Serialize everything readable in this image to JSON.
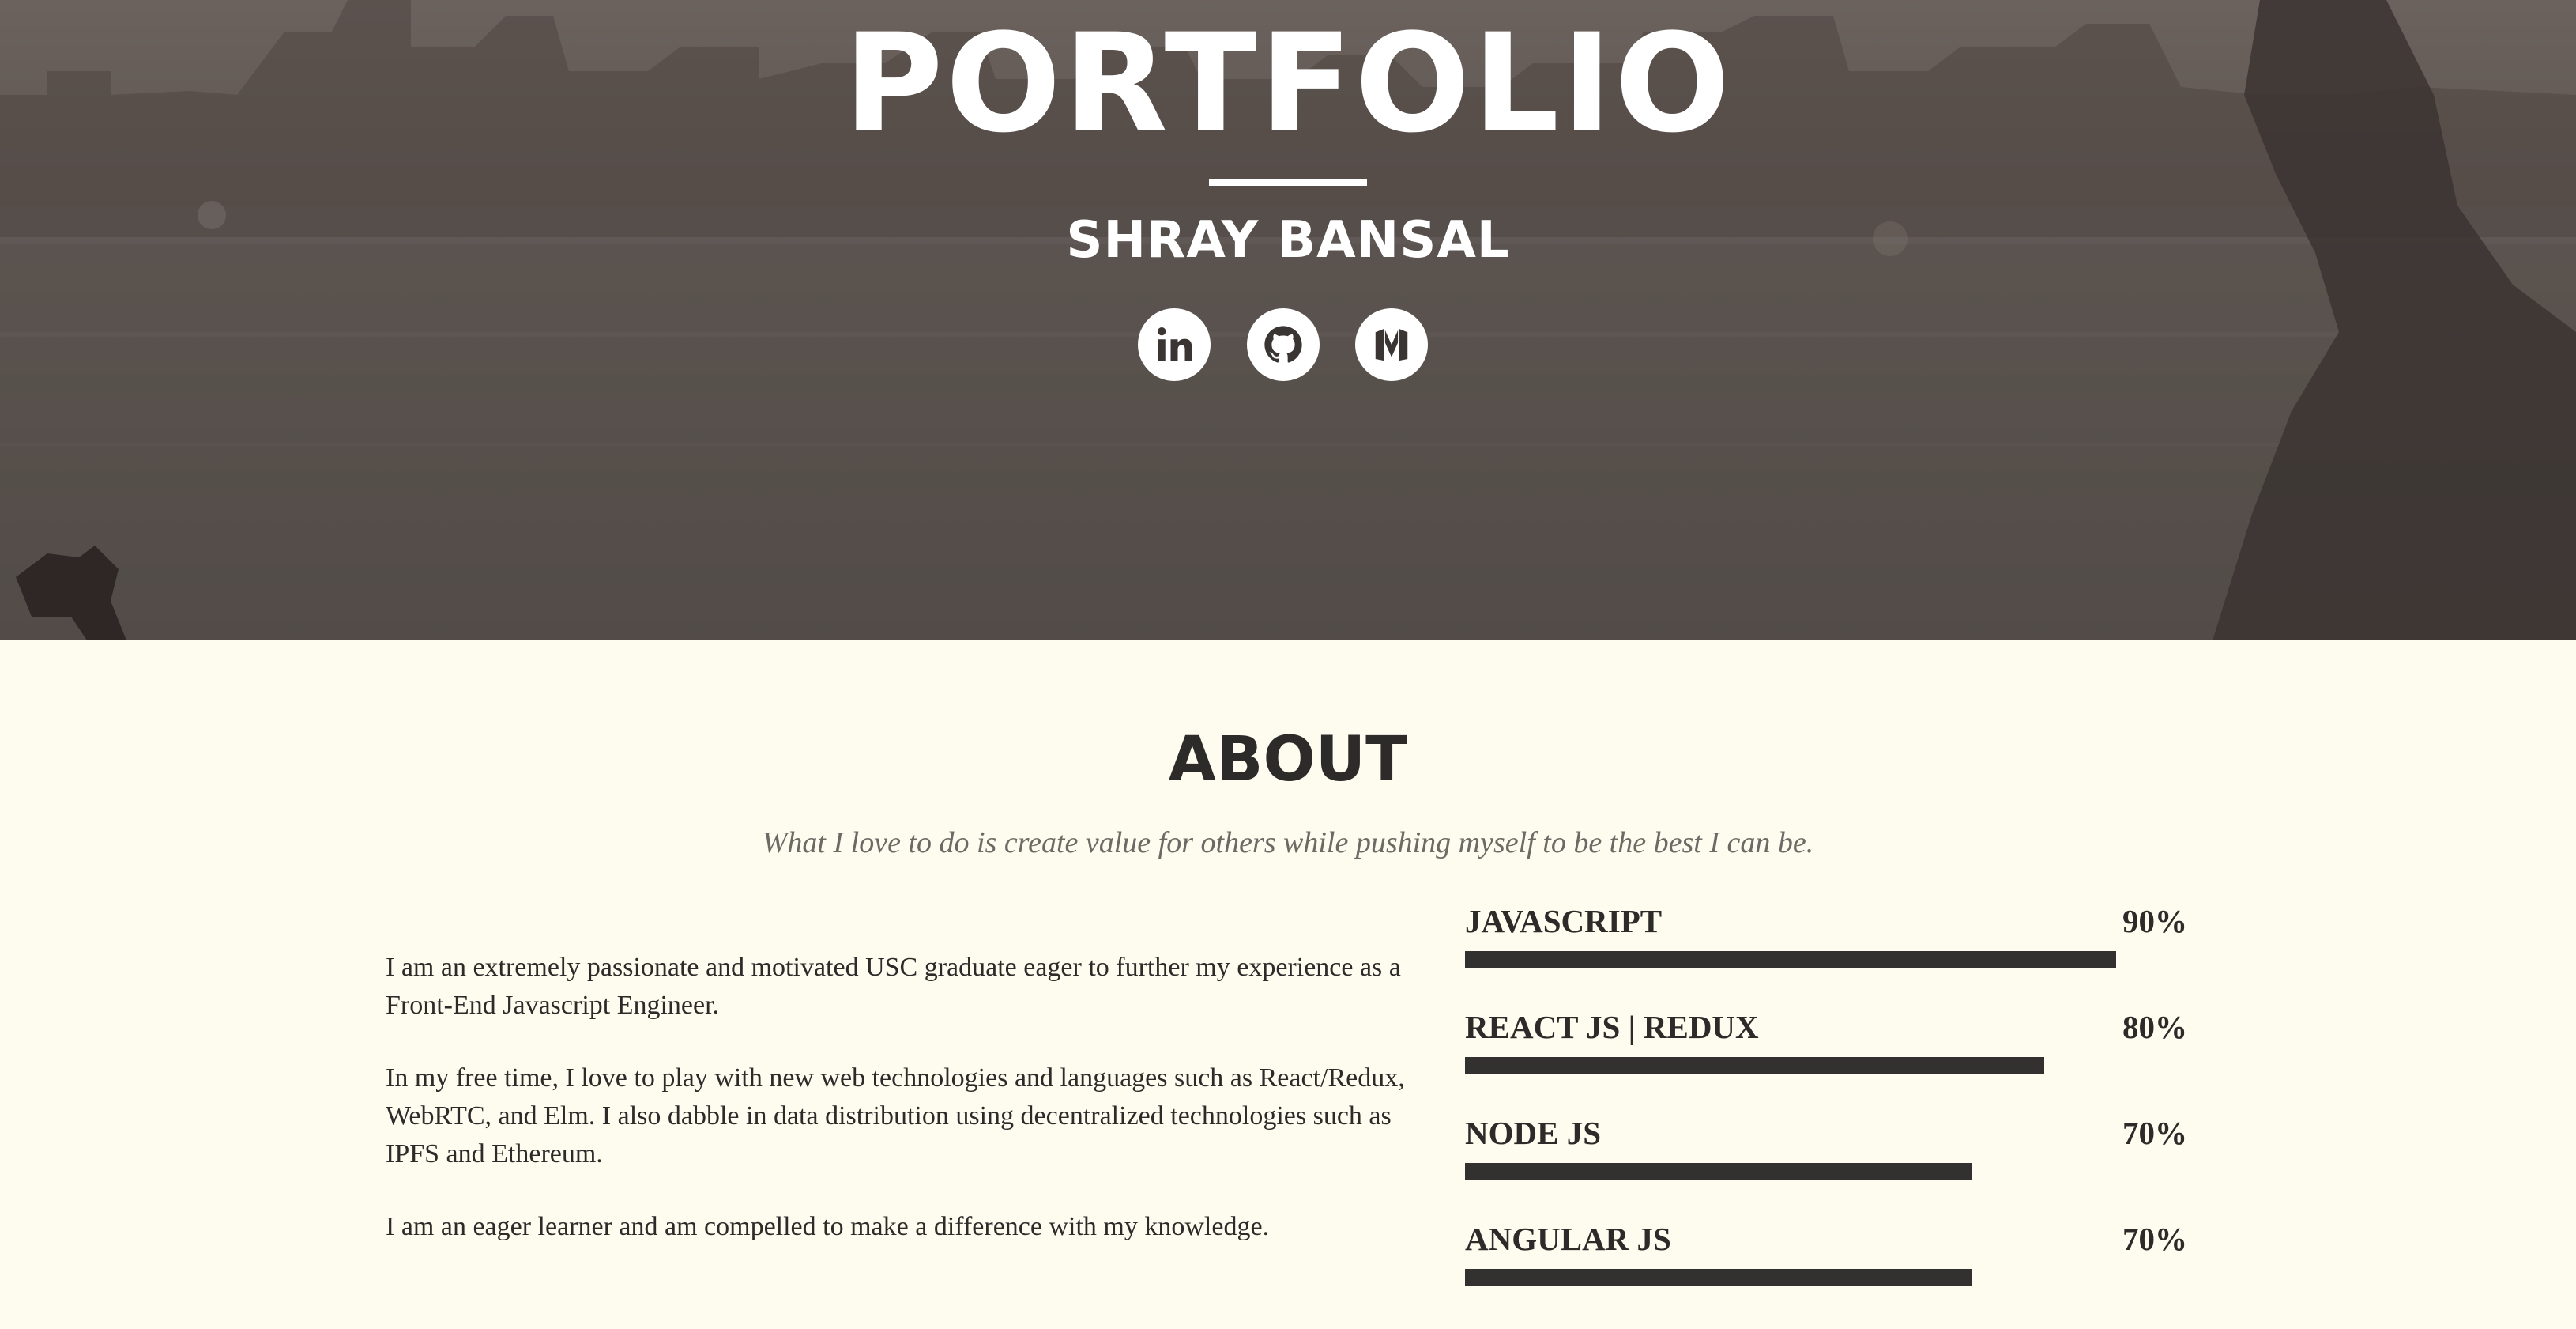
{
  "hero": {
    "title": "PORTFOLIO",
    "name": "SHRAY BANSAL",
    "social": [
      {
        "icon": "linkedin-icon"
      },
      {
        "icon": "github-icon"
      },
      {
        "icon": "medium-icon"
      }
    ]
  },
  "about": {
    "title": "ABOUT",
    "subtitle": "What I love to do is create value for others while pushing myself to be the best I can be.",
    "paragraphs": [
      "I am an extremely passionate and motivated USC graduate eager to further my experience as a Front-End Javascript Engineer.",
      "In my free time, I love to play with new web technologies and languages such as React/Redux, WebRTC, and Elm. I also dabble in data distribution using decentralized technologies such as IPFS and Ethereum.",
      "I am an eager learner and am compelled to make a difference with my knowledge."
    ],
    "skills": [
      {
        "name": "JAVASCRIPT",
        "percent_label": "90%",
        "level": 0.9
      },
      {
        "name": "REACT JS | REDUX",
        "percent_label": "80%",
        "level": 0.8
      },
      {
        "name": "NODE JS",
        "percent_label": "70%",
        "level": 0.7
      },
      {
        "name": "ANGULAR JS",
        "percent_label": "70%",
        "level": 0.7
      }
    ]
  },
  "colors": {
    "page_background": "#fefbef",
    "text_dark": "#2d2b29",
    "subtitle_gray": "#6d6a66",
    "bar": "#333130",
    "hero_overlay": "#5d5550"
  }
}
